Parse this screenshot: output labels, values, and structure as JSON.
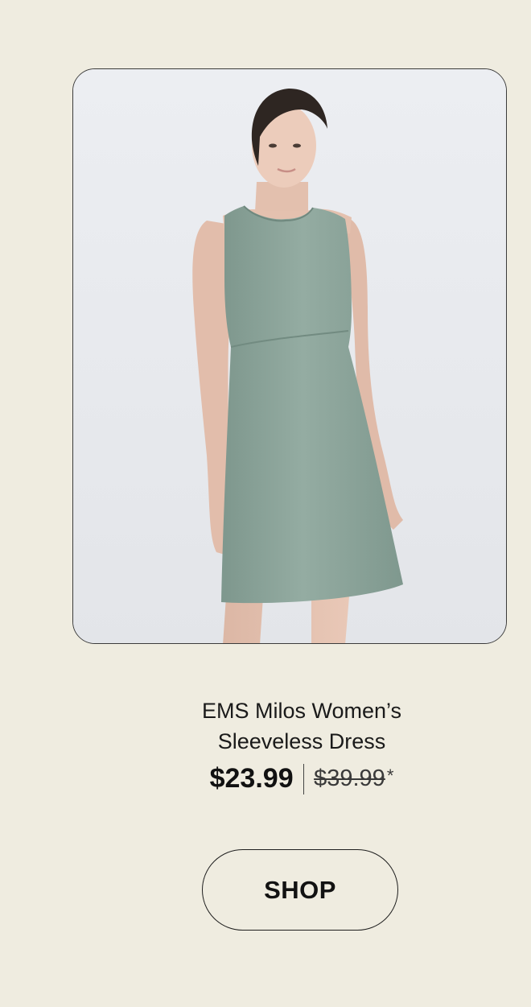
{
  "product": {
    "image_alt": "Woman wearing a sage green sleeveless dress",
    "name_line1": "EMS Milos Women’s",
    "name_line2": "Sleeveless Dress",
    "price_current": "$23.99",
    "price_original": "$39.99",
    "price_note": "*"
  },
  "cta": {
    "label": "SHOP"
  },
  "colors": {
    "background": "#efece0",
    "dress": "#8ea69c",
    "card_border": "#3b3b3b"
  }
}
